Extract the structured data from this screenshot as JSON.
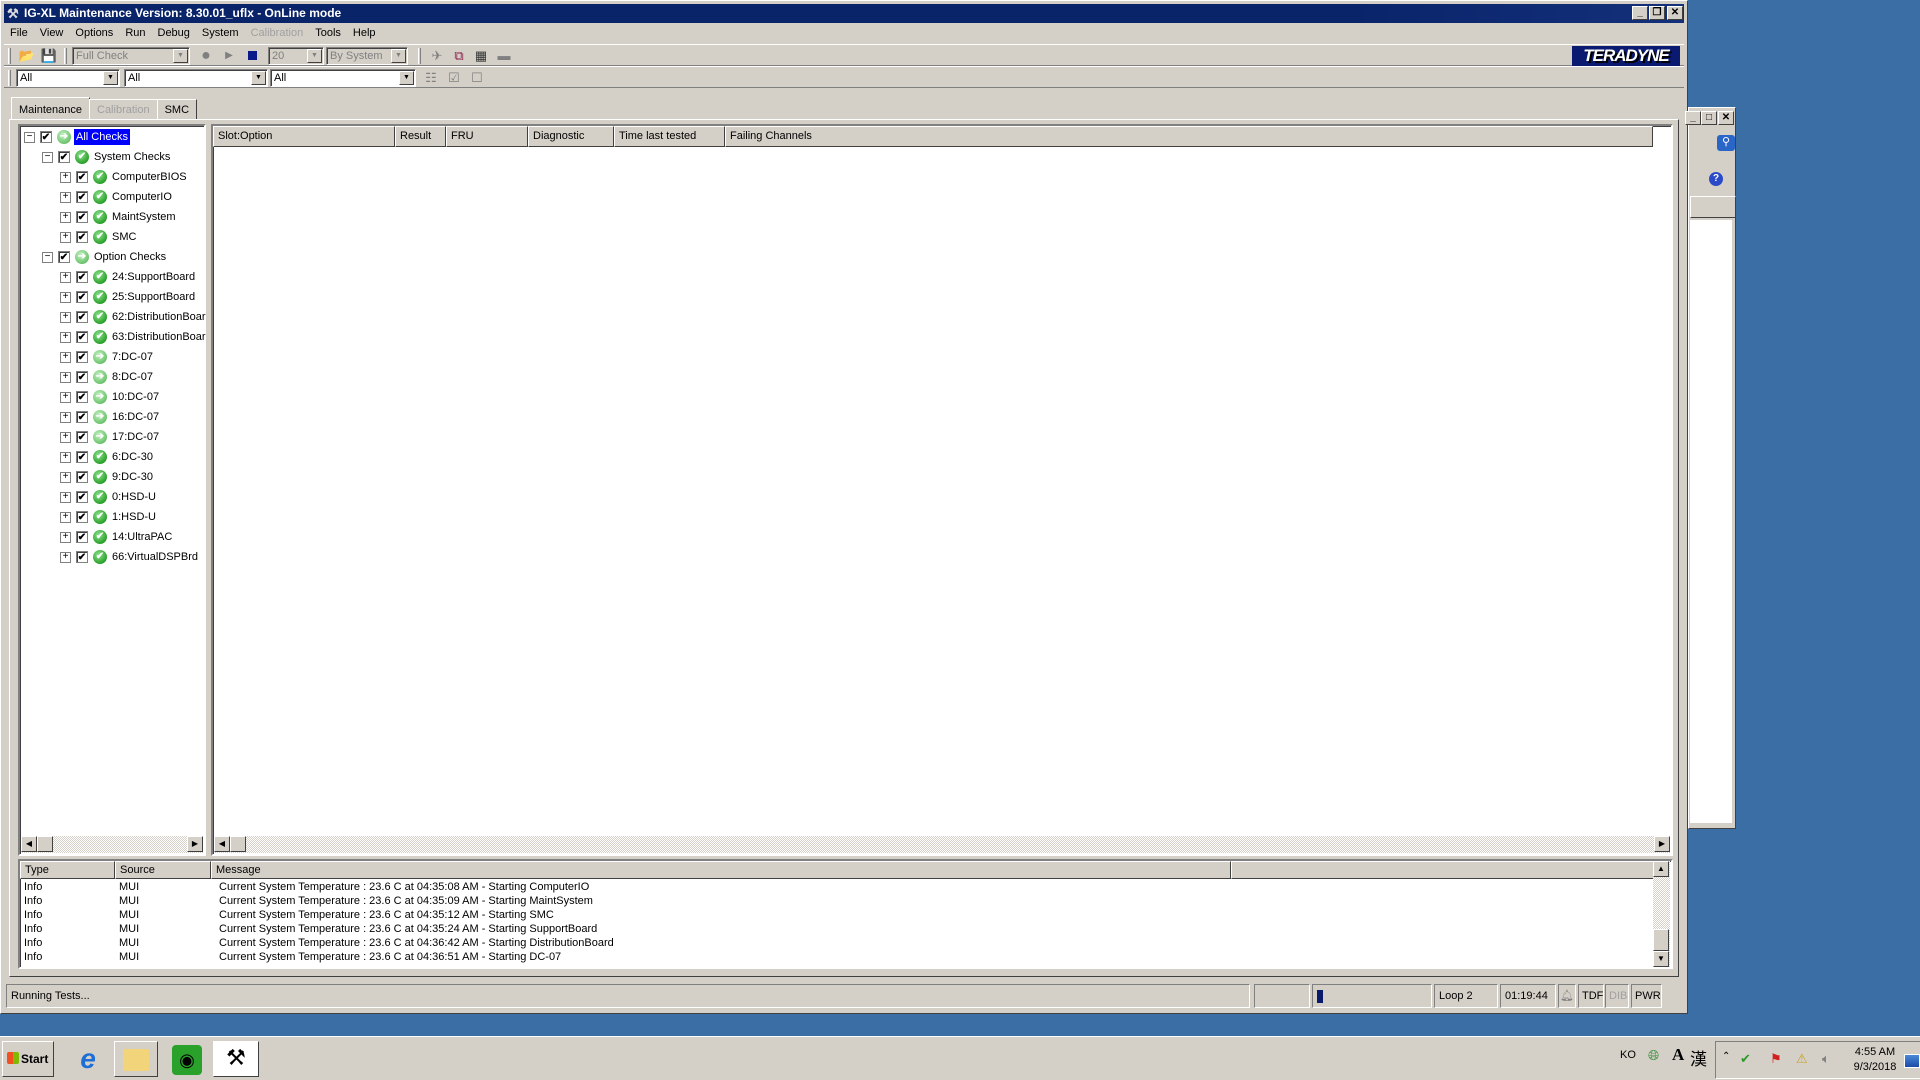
{
  "window": {
    "title": "IG-XL Maintenance Version: 8.30.01_uflx - OnLine mode",
    "controls": {
      "minimize": "_",
      "restore": "❐",
      "close": "✕"
    }
  },
  "menu": [
    "File",
    "View",
    "Options",
    "Run",
    "Debug",
    "System",
    "Calibration",
    "Tools",
    "Help"
  ],
  "menu_disabled": [
    "Calibration"
  ],
  "toolbar1": {
    "check_type": "Full Check",
    "loop_count": "20",
    "run_by": "By System",
    "icons": [
      "open-folder-icon",
      "save-icon",
      "record-icon",
      "play-icon",
      "stop-icon",
      "satellite-icon",
      "windows-icon",
      "calendar-icon",
      "comment-icon"
    ],
    "logo": "TERADYNE"
  },
  "toolbar2": {
    "filter1": "All",
    "filter2": "All",
    "filter3": "All",
    "icons": [
      "tree-list-icon",
      "check-all-icon",
      "uncheck-all-icon"
    ]
  },
  "tabs": [
    {
      "label": "Maintenance",
      "active": true
    },
    {
      "label": "Calibration",
      "disabled": true
    },
    {
      "label": "SMC"
    }
  ],
  "tree": [
    {
      "label": "All Checks",
      "level": 0,
      "expand": "−",
      "checked": true,
      "status": "running",
      "selected": true
    },
    {
      "label": "System Checks",
      "level": 1,
      "expand": "−",
      "checked": true,
      "status": "pass"
    },
    {
      "label": "ComputerBIOS",
      "level": 2,
      "expand": "+",
      "checked": true,
      "status": "pass"
    },
    {
      "label": "ComputerIO",
      "level": 2,
      "expand": "+",
      "checked": true,
      "status": "pass"
    },
    {
      "label": "MaintSystem",
      "level": 2,
      "expand": "+",
      "checked": true,
      "status": "pass"
    },
    {
      "label": "SMC",
      "level": 2,
      "expand": "+",
      "checked": true,
      "status": "pass"
    },
    {
      "label": "Option Checks",
      "level": 1,
      "expand": "−",
      "checked": true,
      "status": "running"
    },
    {
      "label": "24:SupportBoard",
      "level": 2,
      "expand": "+",
      "checked": true,
      "status": "pass"
    },
    {
      "label": "25:SupportBoard",
      "level": 2,
      "expand": "+",
      "checked": true,
      "status": "pass"
    },
    {
      "label": "62:DistributionBoar",
      "level": 2,
      "expand": "+",
      "checked": true,
      "status": "pass"
    },
    {
      "label": "63:DistributionBoar",
      "level": 2,
      "expand": "+",
      "checked": true,
      "status": "pass"
    },
    {
      "label": "7:DC-07",
      "level": 2,
      "expand": "+",
      "checked": true,
      "status": "running"
    },
    {
      "label": "8:DC-07",
      "level": 2,
      "expand": "+",
      "checked": true,
      "status": "running"
    },
    {
      "label": "10:DC-07",
      "level": 2,
      "expand": "+",
      "checked": true,
      "status": "running"
    },
    {
      "label": "16:DC-07",
      "level": 2,
      "expand": "+",
      "checked": true,
      "status": "running"
    },
    {
      "label": "17:DC-07",
      "level": 2,
      "expand": "+",
      "checked": true,
      "status": "running"
    },
    {
      "label": "6:DC-30",
      "level": 2,
      "expand": "+",
      "checked": true,
      "status": "pass"
    },
    {
      "label": "9:DC-30",
      "level": 2,
      "expand": "+",
      "checked": true,
      "status": "pass"
    },
    {
      "label": "0:HSD-U",
      "level": 2,
      "expand": "+",
      "checked": true,
      "status": "pass"
    },
    {
      "label": "1:HSD-U",
      "level": 2,
      "expand": "+",
      "checked": true,
      "status": "pass"
    },
    {
      "label": "14:UltraPAC",
      "level": 2,
      "expand": "+",
      "checked": true,
      "status": "pass"
    },
    {
      "label": "66:VirtualDSPBrd",
      "level": 2,
      "expand": "+",
      "checked": true,
      "status": "pass"
    }
  ],
  "results_grid": {
    "columns": [
      "Slot:Option",
      "Result",
      "FRU",
      "Diagnostic",
      "Time last tested",
      "Failing Channels"
    ],
    "rows": []
  },
  "log": {
    "columns": [
      "Type",
      "Source",
      "Message"
    ],
    "rows": [
      {
        "type": "Info",
        "source": "MUI",
        "message": "Current System Temperature : 23.6 C at 04:35:08 AM - Starting ComputerIO"
      },
      {
        "type": "Info",
        "source": "MUI",
        "message": "Current System Temperature : 23.6 C at 04:35:09 AM - Starting MaintSystem"
      },
      {
        "type": "Info",
        "source": "MUI",
        "message": "Current System Temperature : 23.6 C at 04:35:12 AM - Starting SMC"
      },
      {
        "type": "Info",
        "source": "MUI",
        "message": "Current System Temperature : 23.6 C at 04:35:24 AM - Starting SupportBoard"
      },
      {
        "type": "Info",
        "source": "MUI",
        "message": "Current System Temperature : 23.6 C at 04:36:42 AM - Starting DistributionBoard"
      },
      {
        "type": "Info",
        "source": "MUI",
        "message": "Current System Temperature : 23.6 C at 04:36:51 AM - Starting DC-07"
      }
    ]
  },
  "statusbar": {
    "message": "Running Tests...",
    "progress_fraction": 0.05,
    "loop": "Loop 2",
    "elapsed": "01:19:44",
    "tdf": "TDF",
    "dib": "DIB",
    "pwr": "PWR"
  },
  "taskbar": {
    "start": "Start",
    "lang": "KO",
    "time": "4:55 AM",
    "date": "9/3/2018",
    "ime_a": "A",
    "ime_han": "漢"
  }
}
